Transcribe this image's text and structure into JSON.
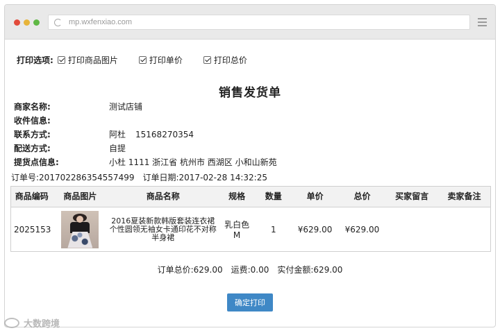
{
  "browser": {
    "url": "mp.wxfenxiao.com"
  },
  "print_options": {
    "title": "打印选项:",
    "options": [
      {
        "label": "打印商品图片",
        "checked": true
      },
      {
        "label": "打印单价",
        "checked": true
      },
      {
        "label": "打印总价",
        "checked": true
      }
    ]
  },
  "document": {
    "title": "销售发货单",
    "info": [
      {
        "label": "商家名称:",
        "value": "测试店铺"
      },
      {
        "label": "收件信息:",
        "value": ""
      },
      {
        "label": "联系方式:",
        "value": "阿杜",
        "value2": "15168270354"
      },
      {
        "label": "配送方式:",
        "value": "自提"
      },
      {
        "label": "提货点信息:",
        "value": "小杜 1111 浙江省 杭州市 西湖区 小和山新苑"
      }
    ],
    "order_no_label": "订单号:",
    "order_no": "201702286354557499",
    "order_date_label": "订单日期:",
    "order_date": "2017-02-28 14:32:25"
  },
  "table": {
    "headers": [
      "商品编码",
      "商品图片",
      "商品名称",
      "规格",
      "数量",
      "单价",
      "总价",
      "买家留言",
      "卖家备注"
    ],
    "rows": [
      {
        "code": "2025153",
        "name": "2016夏装新款韩版套装连衣裙个性圆领无袖女卡通印花不对称半身裙",
        "spec": "乳白色 M",
        "qty": "1",
        "unit_price": "¥629.00",
        "total": "¥629.00",
        "buyer_note": "",
        "seller_note": ""
      }
    ]
  },
  "totals": {
    "order_total_label": "订单总价:",
    "order_total": "629.00",
    "shipping_label": "运费:",
    "shipping": "0.00",
    "paid_label": "实付金额:",
    "paid": "629.00"
  },
  "actions": {
    "print_label": "确定打印"
  },
  "watermark": {
    "text": "大数跨境"
  },
  "colors": {
    "button": "#3f88c6",
    "header_bg": "#f2f2f2"
  }
}
